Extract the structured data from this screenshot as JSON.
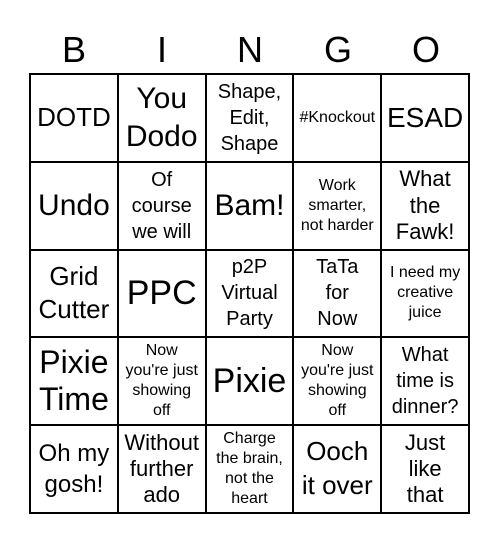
{
  "header": [
    "B",
    "I",
    "N",
    "G",
    "O"
  ],
  "cells": [
    "DOTD",
    "You\nDodo",
    "Shape,\nEdit,\nShape",
    "#Knockout",
    "ESAD",
    "Undo",
    "Of\ncourse\nwe will",
    "Bam!",
    "Work\nsmarter,\nnot harder",
    "What\nthe\nFawk!",
    "Grid\nCutter",
    "PPC",
    "p2P\nVirtual\nParty",
    "TaTa\nfor\nNow",
    "I need my\ncreative\njuice",
    "Pixie\nTime",
    "Now\nyou're just\nshowing\noff",
    "Pixie",
    "Now\nyou're just\nshowing\noff",
    "What\ntime is\ndinner?",
    "Oh my\ngosh!",
    "Without\nfurther\nado",
    "Charge\nthe brain,\nnot the\nheart",
    "Ooch\nit over",
    "Just\nlike\nthat"
  ]
}
